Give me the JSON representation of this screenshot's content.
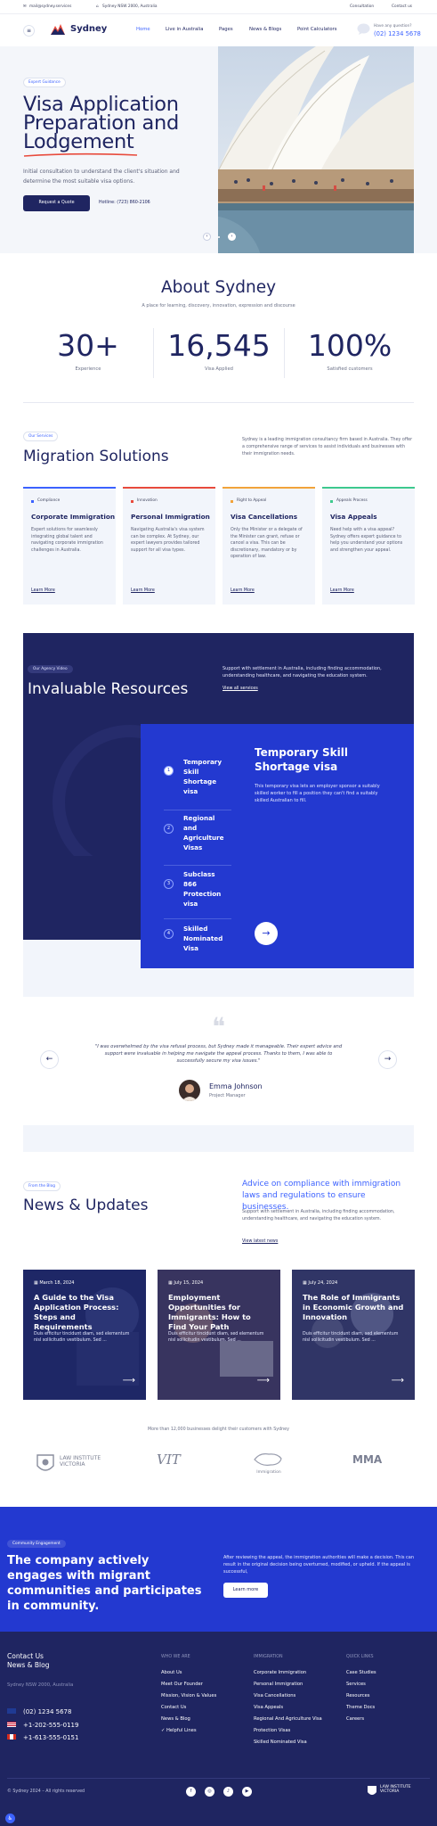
{
  "topbar": {
    "email": "mail@sydney.services",
    "address": "Sydney NSW 2000, Australia",
    "link_consultation": "Consultation",
    "link_contact": "Contact us"
  },
  "header": {
    "brand": "Sydney",
    "nav": [
      "Home",
      "Live in Australia",
      "Pages",
      "News & Blogs",
      "Point Calculators"
    ],
    "question": "Have any question?",
    "phone": "(02) 1234 5678"
  },
  "hero": {
    "tag": "Expert Guidance",
    "title_line1": "Visa Application",
    "title_line2": "Preparation and",
    "title_line3": "Lodgement",
    "description": "Initial consultation to understand the client's situation and determine the most suitable visa options.",
    "cta": "Request a Quote",
    "hotline": "Hotline: (723) 860-2106"
  },
  "about": {
    "title": "About Sydney",
    "subtitle": "A place for learning, discovery, innovation, expression and discourse",
    "stats": [
      {
        "value": "30+",
        "label": "Experience"
      },
      {
        "value": "16,545",
        "label": "Visa Applied"
      },
      {
        "value": "100%",
        "label": "Satisfied customers"
      }
    ]
  },
  "services": {
    "tag": "Our Services",
    "title": "Migration Solutions",
    "intro": "Sydney is a leading immigration consultancy firm based in Australia. They offer a comprehensive range of services to assist individuals and businesses with their immigration needs.",
    "cards": [
      {
        "category": "Compliance",
        "title": "Corporate Immigration",
        "desc": "Expert solutions for seamlessly integrating global talent and navigating corporate immigration challenges in Australia.",
        "link": "Learn More",
        "color": "#3c62ff"
      },
      {
        "category": "Innovation",
        "title": "Personal Immigration",
        "desc": "Navigating Australia's visa system can be complex. At Sydney, our expert lawyers provides tailored support for all visa types.",
        "link": "Learn More",
        "color": "#e84b3c"
      },
      {
        "category": "Right to Appeal",
        "title": "Visa Cancellations",
        "desc": "Only the Minister or a delegate of the Minister can grant, refuse or cancel a visa. This can be discretionary, mandatory or by operation of law.",
        "link": "Learn More",
        "color": "#f2a33a"
      },
      {
        "category": "Appeals Process",
        "title": "Visa Appeals",
        "desc": "Need help with a visa appeal? Sydney offers expert guidance to help you understand your options and strengthen your appeal.",
        "link": "Learn More",
        "color": "#3ec98e"
      }
    ]
  },
  "resources": {
    "tag": "Our Agency Video",
    "title": "Invaluable Resources",
    "desc": "Support with settlement in Australia, including finding accommodation, understanding healthcare, and navigating the education system.",
    "link": "View all services",
    "items": [
      {
        "num": "1",
        "label": "Temporary Skill Shortage visa"
      },
      {
        "num": "2",
        "label": "Regional and Agriculture Visas"
      },
      {
        "num": "3",
        "label": "Subclass 866 Protection visa"
      },
      {
        "num": "4",
        "label": "Skilled Nominated Visa"
      }
    ],
    "active_title": "Temporary Skill Shortage visa",
    "active_desc": "This temporary visa lets an employer sponsor a suitably skilled worker to fill a position they can't find a suitably skilled Australian to fill."
  },
  "testimonial": {
    "quote": "\"I was overwhelmed by the visa refusal process, but Sydney made it manageable. Their expert advice and support were invaluable in helping me navigate the appeal process. Thanks to them, I was able to successfully secure my visa issues.\"",
    "name": "Emma Johnson",
    "role": "Project Manager"
  },
  "news": {
    "tag": "From the Blog",
    "title": "News & Updates",
    "lead": "Advice on compliance with immigration laws and regulations to ensure businesses.",
    "desc": "Support with settlement in Australia, including finding accommodation, understanding healthcare, and navigating the education system.",
    "link": "View latest news",
    "posts": [
      {
        "date": "March 18, 2024",
        "title": "A Guide to the Visa Application Process: Steps and Requirements",
        "desc": "Duis efficitur tincidunt diam, sed elementum nisl sollicitudin vestibulum. Sed ..."
      },
      {
        "date": "July 15, 2024",
        "title": "Employment Opportunities for Immigrants: How to Find Your Path",
        "desc": "Duis efficitur tincidunt diam, sed elementum nisl sollicitudin vestibulum. Sed ..."
      },
      {
        "date": "July 24, 2024",
        "title": "The Role of Immigrants in Economic Growth and Innovation",
        "desc": "Duis efficitur tincidunt diam, sed elementum nisl sollicitudin vestibulum. Sed ..."
      }
    ]
  },
  "clients": {
    "caption": "More than 12,000 businesses delight their customers with Sydney",
    "logos": [
      "LAW INSTITUTE VICTORIA",
      "VIT",
      "Immigration",
      "MMA"
    ]
  },
  "community": {
    "tag": "Community Engagement",
    "title": "The company actively engages with migrant communities and participates in community.",
    "desc": "After reviewing the appeal, the immigration authorities will make a decision. This can result in the original decision being overturned, modified, or upheld. If the appeal is successful,",
    "cta": "Learn more"
  },
  "footer": {
    "contact_title": "Contact Us",
    "news_title": "News & Blog",
    "address": "Sydney NSW 2000, Australia",
    "phones": [
      {
        "flag": "AU",
        "number": "(02) 1234 5678"
      },
      {
        "flag": "US",
        "number": "+1-202-555-0119"
      },
      {
        "flag": "CA",
        "number": "+1-613-555-0151"
      }
    ],
    "col1": {
      "heading": "WHO WE ARE",
      "items": [
        "About Us",
        "Meet Our Founder",
        "Mission, Vision & Values",
        "Contact Us",
        "News & Blog",
        "Helpful Lines"
      ]
    },
    "col2": {
      "heading": "IMMIGRATION",
      "items": [
        "Corporate Immigration",
        "Personal Immigration",
        "Visa Cancellations",
        "Visa Appeals",
        "Regional And Agriculture Visa",
        "Protection Visas",
        "Skilled Nominated Visa"
      ]
    },
    "col3": {
      "heading": "QUICK LINKS",
      "items": [
        "Case Studies",
        "Services",
        "Resources",
        "Theme Docs",
        "Careers"
      ]
    },
    "copyright": "© Sydney 2024 – All rights reserved",
    "footer_logo": "LAW INSTITUTE VICTORIA"
  }
}
